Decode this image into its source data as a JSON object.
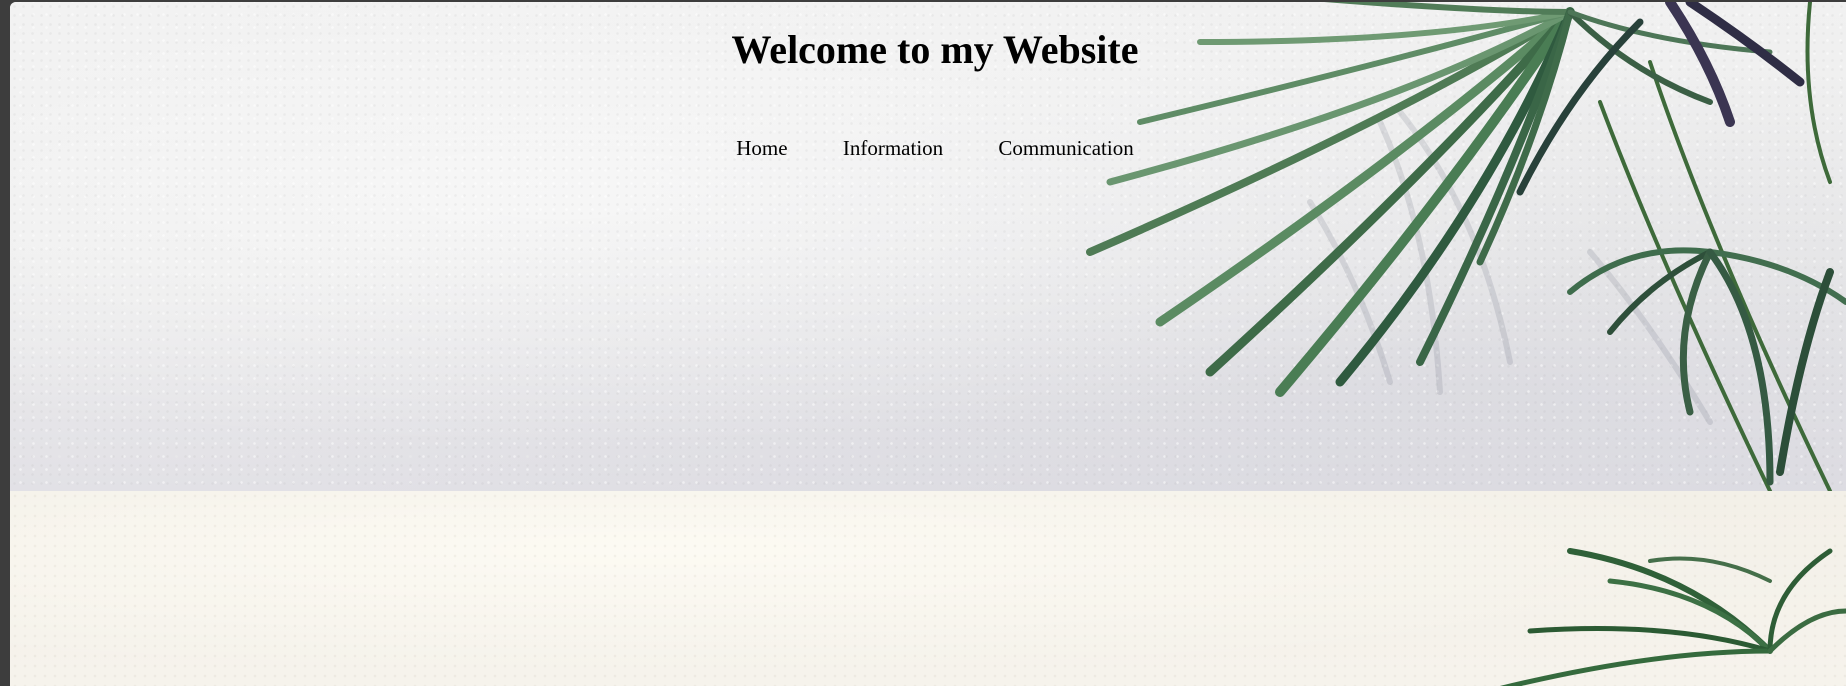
{
  "header": {
    "title": "Welcome to my Website"
  },
  "nav": {
    "items": [
      {
        "label": "Home"
      },
      {
        "label": "Information"
      },
      {
        "label": "Communication"
      }
    ]
  },
  "images": {
    "hero": "palm-plant-against-white-wall",
    "second_section": "palm-plant-against-cream-wall"
  }
}
